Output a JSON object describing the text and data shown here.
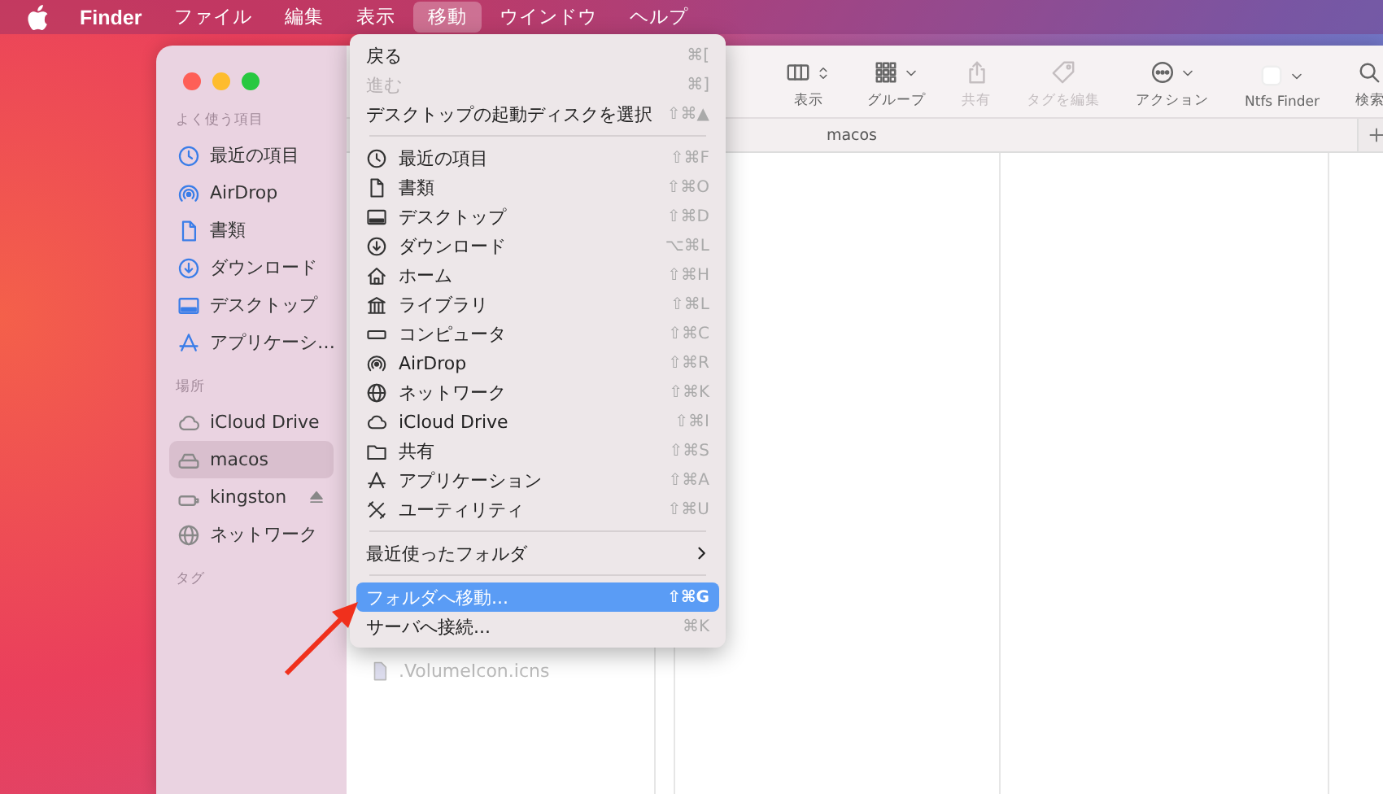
{
  "menubar": {
    "items": [
      {
        "label": "Finder",
        "kind": "app",
        "selected": false
      },
      {
        "label": "ファイル",
        "kind": "menu",
        "selected": false
      },
      {
        "label": "編集",
        "kind": "menu",
        "selected": false
      },
      {
        "label": "表示",
        "kind": "menu",
        "selected": false
      },
      {
        "label": "移動",
        "kind": "menu",
        "selected": true
      },
      {
        "label": "ウインドウ",
        "kind": "menu",
        "selected": false
      },
      {
        "label": "ヘルプ",
        "kind": "menu",
        "selected": false
      }
    ]
  },
  "window": {
    "sidebar": {
      "sections": [
        {
          "heading": "よく使う項目",
          "items": [
            {
              "label": "最近の項目",
              "selected": false,
              "ejectable": false
            },
            {
              "label": "AirDrop",
              "selected": false,
              "ejectable": false
            },
            {
              "label": "書類",
              "selected": false,
              "ejectable": false
            },
            {
              "label": "ダウンロード",
              "selected": false,
              "ejectable": false
            },
            {
              "label": "デスクトップ",
              "selected": false,
              "ejectable": false
            },
            {
              "label": "アプリケーシ…",
              "selected": false,
              "ejectable": false
            }
          ]
        },
        {
          "heading": "場所",
          "items": [
            {
              "label": "iCloud Drive",
              "selected": false,
              "ejectable": false
            },
            {
              "label": "macos",
              "selected": true,
              "ejectable": false
            },
            {
              "label": "kingston",
              "selected": false,
              "ejectable": true
            },
            {
              "label": "ネットワーク",
              "selected": false,
              "ejectable": false
            }
          ]
        },
        {
          "heading": "タグ"
        }
      ]
    },
    "toolbar": {
      "buttons": [
        {
          "label": "表示",
          "disabled": false
        },
        {
          "label": "グループ",
          "disabled": false
        },
        {
          "label": "共有",
          "disabled": true
        },
        {
          "label": "タグを編集",
          "disabled": true
        },
        {
          "label": "アクション",
          "disabled": false
        },
        {
          "label": "Ntfs Finder",
          "disabled": false
        },
        {
          "label": "検索",
          "disabled": false
        }
      ]
    },
    "tab": "macos",
    "files": [
      {
        "name": ".VolumeIcon.icns",
        "hidden": true
      }
    ]
  },
  "menu": {
    "items": [
      {
        "kind": "command",
        "label": "戻る",
        "shortcut": "⌘[",
        "disabled": false,
        "selected": false
      },
      {
        "kind": "command",
        "label": "進む",
        "shortcut": "⌘]",
        "disabled": true,
        "selected": false
      },
      {
        "kind": "command",
        "label": "デスクトップの起動ディスクを選択",
        "shortcut": "⇧⌘▲",
        "disabled": false,
        "selected": false
      },
      {
        "kind": "separator"
      },
      {
        "kind": "place",
        "label": "最近の項目",
        "shortcut": "⇧⌘F",
        "disabled": false,
        "selected": false
      },
      {
        "kind": "place",
        "label": "書類",
        "shortcut": "⇧⌘O",
        "disabled": false,
        "selected": false
      },
      {
        "kind": "place",
        "label": "デスクトップ",
        "shortcut": "⇧⌘D",
        "disabled": false,
        "selected": false
      },
      {
        "kind": "place",
        "label": "ダウンロード",
        "shortcut": "⌥⌘L",
        "disabled": false,
        "selected": false
      },
      {
        "kind": "place",
        "label": "ホーム",
        "shortcut": "⇧⌘H",
        "disabled": false,
        "selected": false
      },
      {
        "kind": "place",
        "label": "ライブラリ",
        "shortcut": "⇧⌘L",
        "disabled": false,
        "selected": false
      },
      {
        "kind": "place",
        "label": "コンピュータ",
        "shortcut": "⇧⌘C",
        "disabled": false,
        "selected": false
      },
      {
        "kind": "place",
        "label": "AirDrop",
        "shortcut": "⇧⌘R",
        "disabled": false,
        "selected": false
      },
      {
        "kind": "place",
        "label": "ネットワーク",
        "shortcut": "⇧⌘K",
        "disabled": false,
        "selected": false
      },
      {
        "kind": "place",
        "label": "iCloud Drive",
        "shortcut": "⇧⌘I",
        "disabled": false,
        "selected": false
      },
      {
        "kind": "place",
        "label": "共有",
        "shortcut": "⇧⌘S",
        "disabled": false,
        "selected": false
      },
      {
        "kind": "place",
        "label": "アプリケーション",
        "shortcut": "⇧⌘A",
        "disabled": false,
        "selected": false
      },
      {
        "kind": "place",
        "label": "ユーティリティ",
        "shortcut": "⇧⌘U",
        "disabled": false,
        "selected": false
      },
      {
        "kind": "separator"
      },
      {
        "kind": "submenu",
        "label": "最近使ったフォルダ",
        "disabled": false,
        "selected": false
      },
      {
        "kind": "separator"
      },
      {
        "kind": "command",
        "label": "フォルダへ移動...",
        "shortcut": "⇧⌘G",
        "disabled": false,
        "selected": true
      },
      {
        "kind": "command",
        "label": "サーバへ接続...",
        "shortcut": "⌘K",
        "disabled": false,
        "selected": false
      }
    ]
  }
}
